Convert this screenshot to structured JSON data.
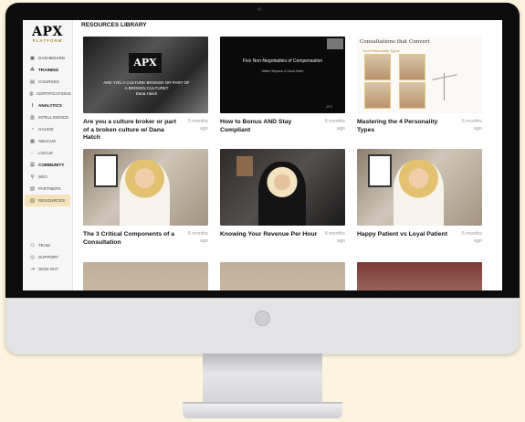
{
  "sidebar": {
    "logo_main": "APX",
    "logo_sub": "PLATFORM",
    "items": [
      {
        "icon": "▣",
        "label": "DASHBOARD",
        "type": "item"
      },
      {
        "icon": "⟁",
        "label": "TRAINING",
        "type": "head"
      },
      {
        "icon": "▤",
        "label": "COURSES",
        "type": "item"
      },
      {
        "icon": "◍",
        "label": "CERTIFICATIONS",
        "type": "item"
      },
      {
        "icon": "⌇",
        "label": "ANALYTICS",
        "type": "head"
      },
      {
        "icon": "▥",
        "label": "INTELLIGENCE",
        "type": "item"
      },
      {
        "icon": "◔",
        "label": "GAUGE",
        "type": "item"
      },
      {
        "icon": "▦",
        "label": "ABACUS",
        "type": "item"
      },
      {
        "icon": "◌",
        "label": "LOCUS",
        "type": "item"
      },
      {
        "icon": "☰",
        "label": "COMMUNITY",
        "type": "head"
      },
      {
        "icon": "⚲",
        "label": "SEO",
        "type": "item"
      },
      {
        "icon": "▧",
        "label": "PARTNERS",
        "type": "item"
      },
      {
        "icon": "▨",
        "label": "RESOURCES",
        "type": "active"
      }
    ],
    "bottom": [
      {
        "icon": "⚇",
        "label": "TEAM"
      },
      {
        "icon": "◎",
        "label": "SUPPORT"
      },
      {
        "icon": "⇥",
        "label": "SIGN OUT"
      }
    ]
  },
  "page": {
    "title": "RESOURCES LIBRARY"
  },
  "cards": [
    {
      "title": "Are you a culture broker or part of a broken culture w/ Dana Hatch",
      "ago": "5 months ago"
    },
    {
      "title": "How to Bonus AND Stay Compliant",
      "ago": "6 months ago"
    },
    {
      "title": "Mastering the 4 Personality Types",
      "ago": "6 months ago"
    },
    {
      "title": "The 3 Critical Components of a Consultation",
      "ago": "6 months ago"
    },
    {
      "title": "Knowing Your Revenue Per Hour",
      "ago": "6 months ago"
    },
    {
      "title": "Happy Patient vs Loyal Patient",
      "ago": "6 months ago"
    }
  ],
  "thumbs": {
    "t1_logo": "APX",
    "t1_text": "ARE YOU A CULTURE BROKER OR PART OF A BROKEN CULTURE?",
    "t1_name": "Dana Hatch",
    "t2_title": "Five Non-Negotiables of Compensation",
    "t2_sub": "Walter Stepanic & Dana Hatch",
    "t2_brand": "APX",
    "t3_title": "Consultations that Convert",
    "t3_sub": "Your Personality Types"
  }
}
